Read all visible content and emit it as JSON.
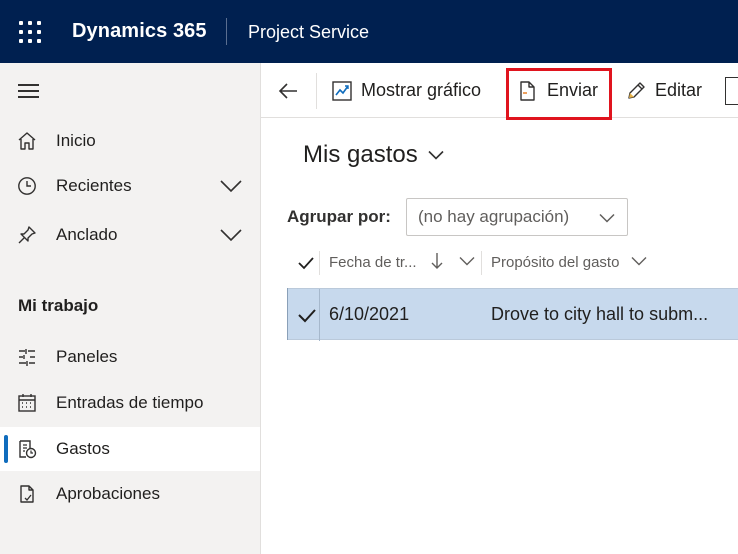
{
  "header": {
    "app_title": "Dynamics 365",
    "module_title": "Project Service"
  },
  "sidebar": {
    "items_top": [
      {
        "label": "Inicio",
        "icon": "home-icon"
      },
      {
        "label": "Recientes",
        "icon": "clock-icon"
      },
      {
        "label": "Anclado",
        "icon": "pin-icon"
      }
    ],
    "section_title": "Mi trabajo",
    "items_work": [
      {
        "label": "Paneles",
        "icon": "dashboard-icon"
      },
      {
        "label": "Entradas de tiempo",
        "icon": "calendar-icon"
      },
      {
        "label": "Gastos",
        "icon": "expense-icon",
        "selected": true
      },
      {
        "label": "Aprobaciones",
        "icon": "approval-document-icon"
      }
    ]
  },
  "command_bar": {
    "show_chart_label": "Mostrar gráfico",
    "submit_label": "Enviar",
    "edit_label": "Editar",
    "highlight_color": "#e0141e"
  },
  "main": {
    "view_title": "Mis gastos",
    "group_by_label": "Agrupar por:",
    "group_by_value": "(no hay agrupación)",
    "columns": [
      "Fecha de tr...",
      "Propósito del gasto"
    ],
    "rows": [
      {
        "date": "6/10/2021",
        "purpose": "Drove to city hall to subm..."
      }
    ]
  },
  "colors": {
    "topbar": "#002050",
    "selected_row": "#c7d9ed",
    "accent": "#0f6cbd"
  }
}
